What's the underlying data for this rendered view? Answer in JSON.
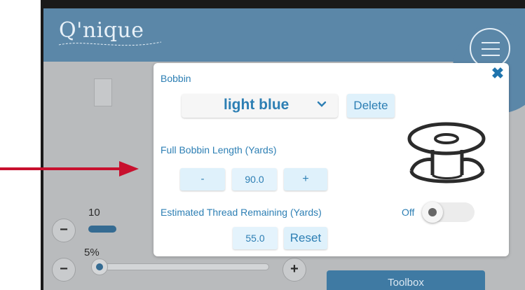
{
  "app": {
    "logo": "Q'nique"
  },
  "modal": {
    "bobbin_label": "Bobbin",
    "color_select": {
      "value": "light blue"
    },
    "delete_label": "Delete",
    "full_length_label": "Full Bobbin Length (Yards)",
    "full_length": {
      "minus": "-",
      "value": "90.0",
      "plus": "+"
    },
    "remaining_label": "Estimated Thread Remaining (Yards)",
    "remaining": {
      "value": "55.0",
      "reset": "Reset"
    },
    "toggle": {
      "label": "Off",
      "state": "off"
    },
    "close_icon": "close-icon",
    "spool_icon": "bobbin-spool-icon"
  },
  "background": {
    "slider_one_value": "10",
    "slider_two_value": "5%",
    "minus_symbol": "−",
    "plus_symbol": "+",
    "toolbox_label": "Toolbox"
  },
  "colors": {
    "header": "#5b87a8",
    "accent_text": "#2d7fb4",
    "button_bg": "#dff1fb",
    "annotation_arrow": "#c8102e"
  }
}
